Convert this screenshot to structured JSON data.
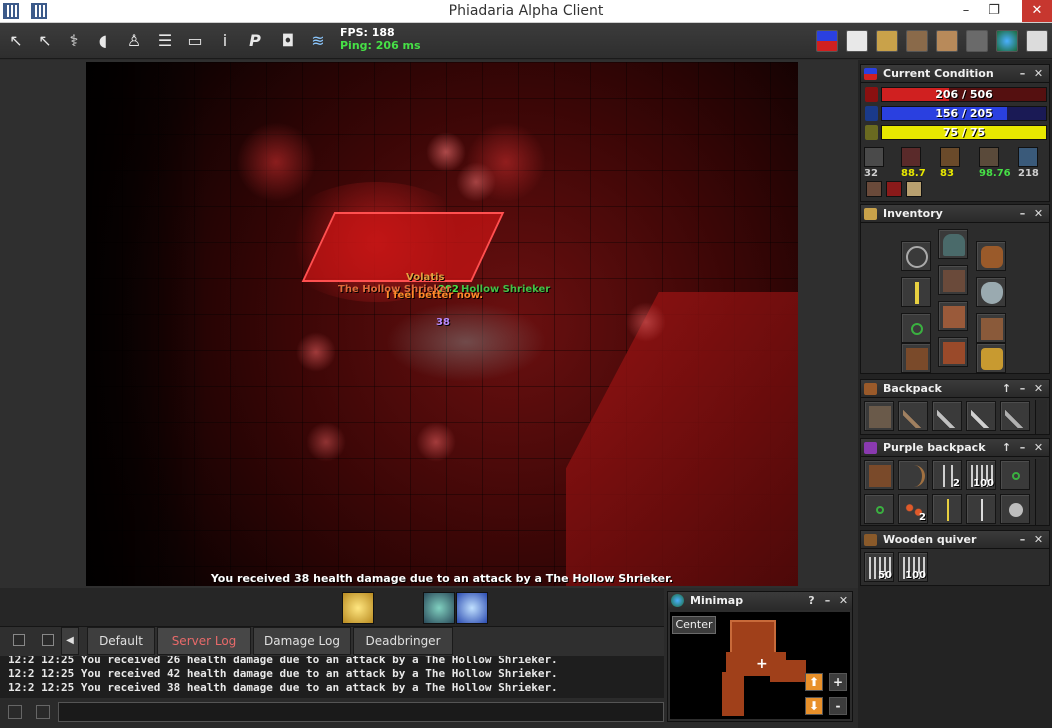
{
  "window": {
    "title": "Phiadaria Alpha Client",
    "minimize": "–",
    "maximize": "❐",
    "close": "✕"
  },
  "toolbar": {
    "left_icons": [
      "arrow-cursor-icon",
      "arrow-cursor-alt-icon",
      "wand-icon",
      "speaker-icon",
      "character-icon",
      "list-icon",
      "window-icon",
      "info-icon",
      "premium-icon",
      "screenshot-icon",
      "scroll-icon"
    ],
    "fps": "FPS: 188",
    "ping": "Ping: 206 ms",
    "right_icons": [
      "health-mana-icon",
      "document-icon",
      "quest-log-icon",
      "battle-icon",
      "party-icon",
      "options-icon",
      "world-icon",
      "logout-icon"
    ]
  },
  "game": {
    "overhead_name": "Volatis",
    "overhead_damage_a": "202",
    "overhead_creature": "The Hollow Shrieker",
    "overhead_creature_b": "Hollow Shrieker",
    "overhead_speech": "I feel better now.",
    "overhead_hit": "38",
    "status_message": "You received 38 health damage due to an attack by a The Hollow Shrieker."
  },
  "condition": {
    "title": "Current Condition",
    "health": {
      "value": 206,
      "max": 506,
      "text": "206 / 506",
      "color": "#d02020"
    },
    "mana": {
      "value": 156,
      "max": 205,
      "text": "156 / 205",
      "color": "#2a40e0"
    },
    "energy": {
      "value": 75,
      "max": 75,
      "text": "75 / 75",
      "color": "#e8e800"
    },
    "stats": [
      {
        "icon": "level-icon",
        "value": "32",
        "color": "#cfcfcf"
      },
      {
        "icon": "sword-skill-icon",
        "value": "88.7",
        "color": "#e8e800"
      },
      {
        "icon": "food-icon",
        "value": "83",
        "color": "#e8e800"
      },
      {
        "icon": "capacity-icon",
        "value": "98.76",
        "color": "#46e046"
      },
      {
        "icon": "speed-icon",
        "value": "218",
        "color": "#cfcfcf"
      }
    ],
    "buffs": [
      "strength-buff-icon",
      "blood-buff-icon",
      "scroll-buff-icon"
    ]
  },
  "inventory": {
    "title": "Inventory",
    "slots": [
      "amulet-slot-icon",
      "helmet-icon",
      "backpack-icon",
      "sword-icon",
      "armor-icon",
      "shield-icon",
      "ring-icon",
      "legs-icon",
      "gloves-icon",
      "bag-icon",
      "boots-icon",
      "gold-pile-icon"
    ]
  },
  "backpack": {
    "title": "Backpack",
    "items": [
      "leather-armor-icon",
      "war-hammer-icon",
      "short-sword-icon",
      "long-sword-icon",
      "mace-icon"
    ]
  },
  "purple_backpack": {
    "title": "Purple backpack",
    "items": [
      {
        "icon": "crossbow-icon",
        "count": ""
      },
      {
        "icon": "bow-icon",
        "count": ""
      },
      {
        "icon": "arrows-icon",
        "count": "2"
      },
      {
        "icon": "arrow-bundle-icon",
        "count": "100"
      },
      {
        "icon": "green-ring-icon",
        "count": ""
      },
      {
        "icon": "green-ring-small-icon",
        "count": ""
      },
      {
        "icon": "gems-icon",
        "count": "2"
      },
      {
        "icon": "dagger-icon",
        "count": ""
      },
      {
        "icon": "ankh-key-icon",
        "count": ""
      },
      {
        "icon": "skull-icon",
        "count": ""
      }
    ]
  },
  "quiver": {
    "title": "Wooden quiver",
    "items": [
      {
        "icon": "arrow-bundle-icon",
        "count": "50"
      },
      {
        "icon": "arrow-bundle-icon",
        "count": "100"
      }
    ]
  },
  "chat": {
    "tabs": [
      "Default",
      "Server Log",
      "Damage Log",
      "Deadbringer"
    ],
    "active_tab": "Server Log",
    "lines": [
      {
        "time": "12:2",
        "text": "12:25 You received 26 health damage due to an attack by a The Hollow Shrieker."
      },
      {
        "time": "12:2",
        "text": "12:25 You received 42 health damage due to an attack by a The Hollow Shrieker."
      },
      {
        "time": "12:2",
        "text": "12:25 You received 38 health damage due to an attack by a The Hollow Shrieker."
      }
    ],
    "input_value": ""
  },
  "minimap": {
    "title": "Minimap",
    "help": "?",
    "center_button": "Center",
    "zoom_in": "+",
    "zoom_out": "-"
  },
  "colors": {
    "accent_red": "#c7372f",
    "health": "#d02020",
    "mana": "#2a40e0",
    "energy": "#e8e800",
    "ping_green": "#46e046"
  }
}
